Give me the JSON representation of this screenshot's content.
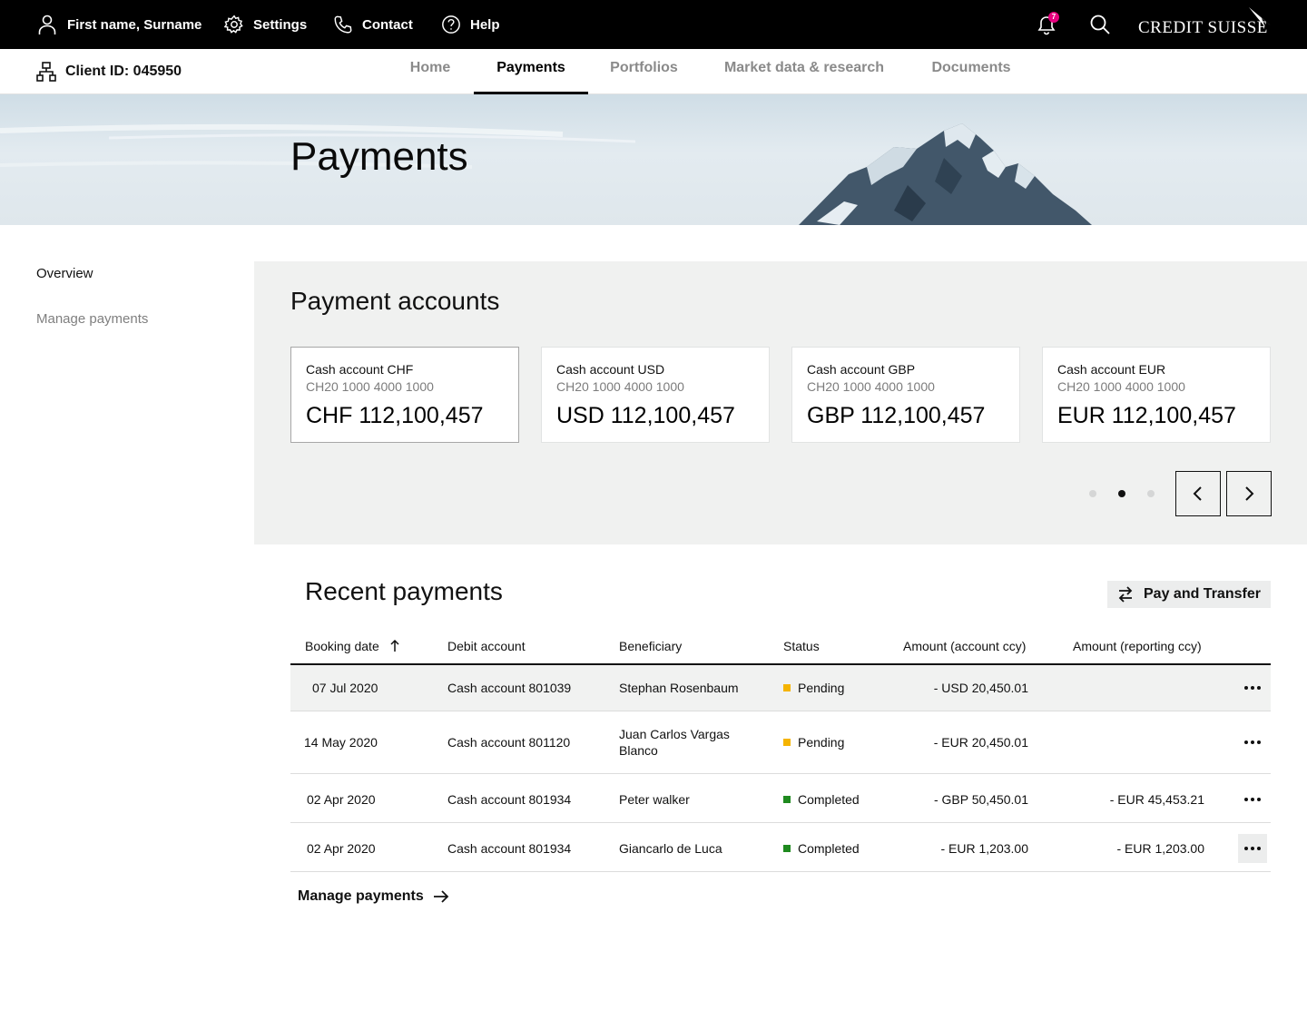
{
  "topbar": {
    "user_label": "First name, Surname",
    "settings_label": "Settings",
    "contact_label": "Contact",
    "help_label": "Help",
    "notification_count": "7",
    "logo_text": "CREDIT SUISSE",
    "icons": [
      "user-icon",
      "gear-icon",
      "phone-icon",
      "help-icon",
      "bell-icon",
      "search-icon",
      "sail-logo-icon"
    ]
  },
  "subnav": {
    "client_label": "Client ID: 045950",
    "tabs": [
      {
        "label": "Home",
        "active": false
      },
      {
        "label": "Payments",
        "active": true
      },
      {
        "label": "Portfolios",
        "active": false
      },
      {
        "label": "Market data & research",
        "active": false
      },
      {
        "label": "Documents",
        "active": false
      }
    ]
  },
  "hero": {
    "title": "Payments"
  },
  "sidenav": {
    "items": [
      {
        "label": "Overview",
        "active": true
      },
      {
        "label": "Manage payments",
        "active": false
      }
    ]
  },
  "accounts": {
    "title": "Payment accounts",
    "cards": [
      {
        "name": "Cash account CHF",
        "iban": "CH20 1000 4000 1000",
        "amount": "CHF 112,100,457",
        "selected": true
      },
      {
        "name": "Cash account USD",
        "iban": "CH20 1000 4000 1000",
        "amount": "USD 112,100,457",
        "selected": false
      },
      {
        "name": "Cash account GBP",
        "iban": "CH20 1000 4000 1000",
        "amount": "GBP 112,100,457",
        "selected": false
      },
      {
        "name": "Cash account EUR",
        "iban": "CH20 1000 4000 1000",
        "amount": "EUR 112,100,457",
        "selected": false
      }
    ],
    "pagination": {
      "pages": 3,
      "current": 2
    }
  },
  "payments": {
    "title": "Recent payments",
    "pay_button_label": "Pay and Transfer",
    "columns": [
      "Booking date",
      "Debit account",
      "Beneficiary",
      "Status",
      "Amount (account ccy)",
      "Amount (reporting ccy)"
    ],
    "sort": {
      "column": "Booking date",
      "direction": "ascending"
    },
    "rows": [
      {
        "date": "07 Jul 2020",
        "debit": "Cash account 801039",
        "beneficiary": "Stephan Rosenbaum",
        "beneficiary_line2": "",
        "status": "Pending",
        "amount_account": "- USD 20,450.01",
        "amount_reporting": ""
      },
      {
        "date": "14 May 2020",
        "debit": "Cash account 801120",
        "beneficiary": "Juan Carlos Vargas",
        "beneficiary_line2": "Blanco",
        "status": "Pending",
        "amount_account": "- EUR 20,450.01",
        "amount_reporting": ""
      },
      {
        "date": "02 Apr 2020",
        "debit": "Cash account 801934",
        "beneficiary": "Peter walker",
        "beneficiary_line2": "",
        "status": "Completed",
        "amount_account": "- GBP 50,450.01",
        "amount_reporting": "- EUR 45,453.21"
      },
      {
        "date": "02 Apr 2020",
        "debit": "Cash account 801934",
        "beneficiary": "Giancarlo de Luca",
        "beneficiary_line2": "",
        "status": "Completed",
        "amount_account": "- EUR 1,203.00",
        "amount_reporting": "- EUR 1,203.00"
      }
    ],
    "status_colors": {
      "Pending": "#f5b400",
      "Completed": "#1f8a1f"
    },
    "manage_link_label": "Manage payments"
  }
}
